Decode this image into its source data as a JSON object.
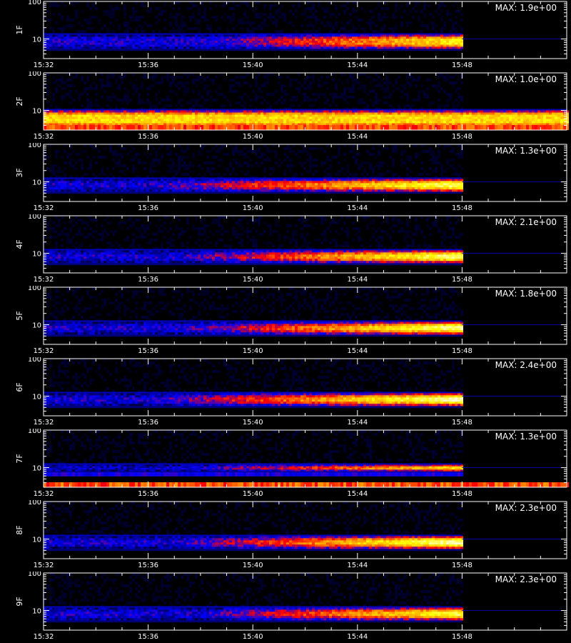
{
  "chart_data": {
    "type": "heatmap",
    "x_tick_labels": [
      "15:32",
      "15:36",
      "15:40",
      "15:44",
      "15:48"
    ],
    "y_tick_labels": [
      "100",
      "10"
    ],
    "x_range": [
      "15:32",
      "15:52"
    ],
    "y_range": [
      3,
      100
    ],
    "y_scale": "log",
    "data_end_time": "15:48",
    "colormap": [
      "#00003a",
      "#0000ff",
      "#ff0000",
      "#ffa000",
      "#ffff00",
      "#ffffe0"
    ],
    "panels": [
      {
        "label": "1F",
        "max_text": "MAX: 1.9e+00",
        "band_low": 5.5,
        "band_high": 13,
        "ramp_start": "15:38",
        "peak_intensity": 0.78,
        "blue_strip": false
      },
      {
        "label": "2F",
        "max_text": "MAX: 1.0e+00",
        "band_low": 3.5,
        "band_high": 10,
        "ramp_start": "15:32",
        "peak_intensity": 0.85,
        "blue_strip": false
      },
      {
        "label": "3F",
        "max_text": "MAX: 1.3e+00",
        "band_low": 5.5,
        "band_high": 12,
        "ramp_start": "15:36",
        "peak_intensity": 0.9,
        "blue_strip": false
      },
      {
        "label": "4F",
        "max_text": "MAX: 2.1e+00",
        "band_low": 5.5,
        "band_high": 12,
        "ramp_start": "15:37",
        "peak_intensity": 0.92,
        "blue_strip": false
      },
      {
        "label": "5F",
        "max_text": "MAX: 1.8e+00",
        "band_low": 5.5,
        "band_high": 12,
        "ramp_start": "15:37",
        "peak_intensity": 0.93,
        "blue_strip": false
      },
      {
        "label": "6F",
        "max_text": "MAX: 2.4e+00",
        "band_low": 5.5,
        "band_high": 12,
        "ramp_start": "15:36",
        "peak_intensity": 0.95,
        "blue_strip": false
      },
      {
        "label": "7F",
        "max_text": "MAX: 1.3e+00",
        "band_low": 8,
        "band_high": 12,
        "ramp_start": "15:37",
        "peak_intensity": 0.9,
        "blue_strip": true
      },
      {
        "label": "8F",
        "max_text": "MAX: 2.3e+00",
        "band_low": 5.5,
        "band_high": 12,
        "ramp_start": "15:37",
        "peak_intensity": 0.95,
        "blue_strip": false
      },
      {
        "label": "9F",
        "max_text": "MAX: 2.3e+00",
        "band_low": 5.5,
        "band_high": 12,
        "ramp_start": "15:38",
        "peak_intensity": 0.85,
        "blue_strip": false
      }
    ]
  }
}
